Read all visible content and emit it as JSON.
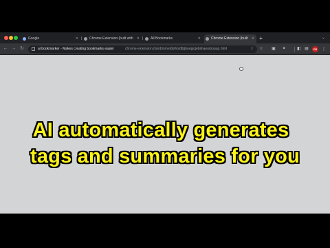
{
  "browser": {
    "tabs": [
      {
        "label": "Google",
        "active": false
      },
      {
        "label": "Chrome Extension (built with",
        "active": false
      },
      {
        "label": "All Bookmarks",
        "active": false
      },
      {
        "label": "Chrome Extension (built",
        "active": true
      }
    ],
    "new_tab_label": "+",
    "omnibox": {
      "title": "ai bookmarker - Makes creating bookmarks easier",
      "url": "chrome-extension://ambmmeldoiholdfpjboepjcjebilnaeo/popup.html"
    },
    "profile_initials": "FR"
  },
  "caption": {
    "line1": "AI automatically generates",
    "line2": "tags and summaries for you"
  },
  "colors": {
    "caption_text": "#fbf31a",
    "page_background": "#d3d4d6",
    "tabstrip": "#202124",
    "toolbar": "#35363a"
  }
}
